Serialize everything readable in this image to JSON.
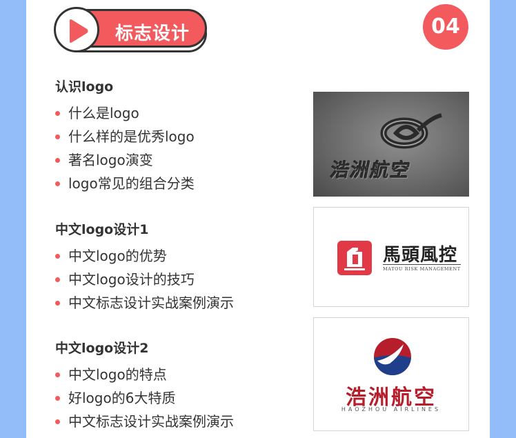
{
  "header": {
    "title": "标志设计",
    "number": "04",
    "icon": "play-icon",
    "accent_color": "#f25a5d"
  },
  "sections": [
    {
      "title": "认识logo",
      "items": [
        "什么是logo",
        "什么样的是优秀logo",
        "著名logo演变",
        "logo常见的组合分类"
      ]
    },
    {
      "title": "中文logo设计1",
      "items": [
        "中文logo的优势",
        "中文logo设计的技巧",
        "中文标志设计实战案例演示"
      ]
    },
    {
      "title": "中文logo设计2",
      "items": [
        "中文logo的特点",
        "好logo的6大特质",
        "中文标志设计实战案例演示"
      ]
    }
  ],
  "images": {
    "mockup": {
      "text": "浩洲航空"
    },
    "mt_logo": {
      "name": "馬頭風控",
      "sub": "MATOU RISK MANAGEMENT"
    },
    "hz_logo": {
      "name": "浩洲航空",
      "sub": "HAOZHOU AIRLINES"
    }
  }
}
